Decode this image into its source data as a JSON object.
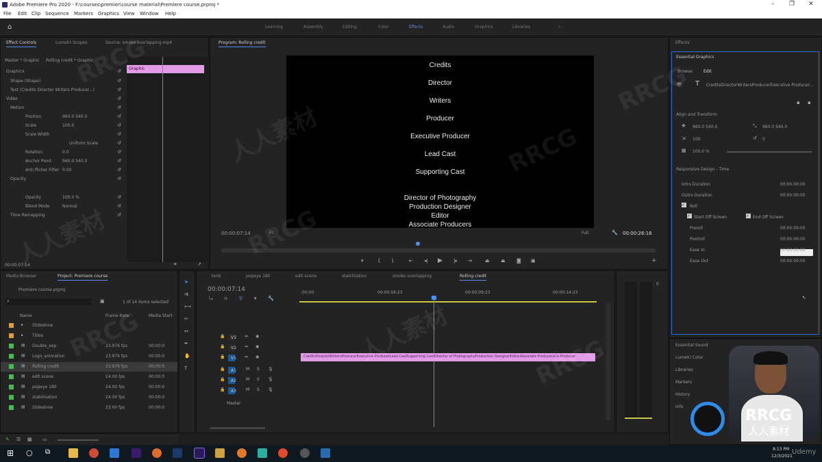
{
  "app": {
    "title": "Adobe Premiere Pro 2020 - F:\\courses\\premier\\course material\\Premiere course.prproj *"
  },
  "menu": [
    "File",
    "Edit",
    "Clip",
    "Sequence",
    "Markers",
    "Graphics",
    "View",
    "Window",
    "Help"
  ],
  "workspaces": {
    "items": [
      "Learning",
      "Assembly",
      "Editing",
      "Color",
      "Effects",
      "Audio",
      "Graphics",
      "Libraries"
    ],
    "active": "Effects",
    "more": "»"
  },
  "effect_controls": {
    "tabs": [
      "Effect Controls",
      "Lumetri Scopes",
      "Source: smoke overlapping.mp4"
    ],
    "master": "Master * Graphic",
    "sequence_clip": "Rolling credit * Graphic",
    "graphic_label": "Graphic",
    "rows": [
      {
        "label": "Graphics",
        "value": ""
      },
      {
        "label": "Shape (Shape)",
        "value": ""
      },
      {
        "label": "Text (Credits Director Writers Producer...)",
        "value": ""
      },
      {
        "label": "Video",
        "value": ""
      },
      {
        "label": "Motion",
        "value": ""
      },
      {
        "label": "Position",
        "value": "960.0    540.0"
      },
      {
        "label": "Scale",
        "value": "100.0"
      },
      {
        "label": "Scale Width",
        "value": ""
      },
      {
        "label": "Uniform Scale",
        "value": ""
      },
      {
        "label": "Rotation",
        "value": "0.0"
      },
      {
        "label": "Anchor Point",
        "value": "960.0    540.0"
      },
      {
        "label": "Anti-flicker Filter",
        "value": "0.00"
      },
      {
        "label": "Opacity",
        "value": ""
      },
      {
        "label": "Opacity",
        "value": "100.0 %"
      },
      {
        "label": "Blend Mode",
        "value": "Normal"
      },
      {
        "label": "Time Remapping",
        "value": ""
      }
    ],
    "timecode": "00:00:07:14"
  },
  "program": {
    "title": "Program: Rolling credit",
    "credits": [
      "Credits",
      "Director",
      "Writers",
      "Producer",
      "Executive Producer",
      "Lead Cast",
      "Supporting Cast"
    ],
    "credits_block": [
      "Director of Photography",
      "Production Designer",
      "Editor",
      "Associate Producers"
    ],
    "timecode_left": "00:00:07:14",
    "fit": "Fit",
    "zoom": "Full",
    "timecode_right": "00:00:26:16"
  },
  "essential_graphics": {
    "header": "Effects",
    "title": "Essential Graphics",
    "tabs": [
      "Browse",
      "Edit"
    ],
    "layer_text": "CreditsDirectorWritersProducerExecutive Producer...",
    "section_align": "Align and Transform",
    "position": "960.0    540.0",
    "anchor": "960.0    540.0",
    "scale": "100",
    "rotation": "0",
    "opacity": "100.0 %",
    "responsive_title": "Responsive Design - Time",
    "rows": [
      "Intro Duration",
      "Outro Duration",
      "Roll",
      "Start Off Screen",
      "End Off Screen",
      "Preroll",
      "Postroll",
      "Ease In",
      "Ease Out"
    ],
    "values": [
      "00:00:00:00",
      "00:00:00:00",
      "00:00:00:00",
      "00:00:00:00",
      "00:00:00:00",
      "00:00:00:00"
    ],
    "bottom_items": [
      "Essential Sound",
      "Lumetri Color",
      "Libraries",
      "Markers",
      "History",
      "Info"
    ]
  },
  "project": {
    "tabs": [
      "Media Browser",
      "Project: Premiere course"
    ],
    "file": "Premiere course.prproj",
    "count": "1 of 14 items selected",
    "cols": [
      "Name",
      "Frame Rate",
      "Media Start"
    ],
    "items": [
      {
        "name": "Slideshow",
        "rate": "",
        "start": "",
        "color": "#e89a2c"
      },
      {
        "name": "Titles",
        "rate": "",
        "start": "",
        "color": "#e89a2c"
      },
      {
        "name": "Double_exp",
        "rate": "23.976 fps",
        "start": "00:00:0",
        "color": "#3cc24a"
      },
      {
        "name": "Logo_animation",
        "rate": "23.976 fps",
        "start": "00:00:0",
        "color": "#3cc24a"
      },
      {
        "name": "Rolling credit",
        "rate": "23.976 fps",
        "start": "00:00:0",
        "color": "#3cc24a"
      },
      {
        "name": "edit scene",
        "rate": "24.00 fps",
        "start": "00:00:0",
        "color": "#3cc24a"
      },
      {
        "name": "popeye 180",
        "rate": "24.00 fps",
        "start": "00:00:0",
        "color": "#3cc24a"
      },
      {
        "name": "stabilization",
        "rate": "24.00 fps",
        "start": "00:00:0",
        "color": "#3cc24a"
      },
      {
        "name": "Slideshow",
        "rate": "23.00 fps",
        "start": "00:00:0",
        "color": "#3cc24a"
      }
    ]
  },
  "timeline": {
    "tabs": [
      "bmb",
      "popeye 180",
      "edit scene",
      "stabilization",
      "smoke overlapping",
      "Rolling credit"
    ],
    "timecode": "00:00:07:14",
    "ruler": [
      ":00:00",
      "00:00:04:23",
      "00:00:09:23",
      "00:00:14:23"
    ],
    "video_tracks": [
      "V3",
      "V2",
      "V1"
    ],
    "audio_tracks": [
      "A1",
      "A2",
      "A3"
    ],
    "master": "Master",
    "clip_label": "CreditsDirectorWritersProducerExecutive ProducerLead CastSupporting CastDirector of PhotographyProduction DesignerEditorAssociate ProducersCo-Producer"
  },
  "taskbar": {
    "time": "8:13 PM",
    "date": "12/3/2021"
  },
  "watermark": {
    "brand": "RRCG",
    "cn": "人人素材",
    "udemy": "Udemy"
  },
  "colors": {
    "accent": "#5b8def",
    "clip": "#e29be6",
    "playhead": "#4b8ef0"
  }
}
